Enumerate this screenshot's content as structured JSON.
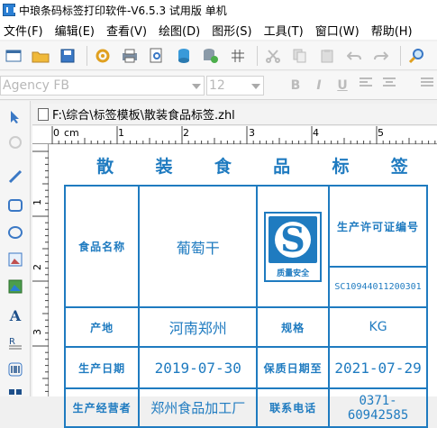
{
  "window": {
    "title": "中琅条码标签打印软件-V6.5.3 试用版 单机"
  },
  "menu": {
    "items": [
      "文件(F)",
      "编辑(E)",
      "查看(V)",
      "绘图(D)",
      "图形(S)",
      "工具(T)",
      "窗口(W)",
      "帮助(H)"
    ]
  },
  "format": {
    "font_name": "Agency FB",
    "font_size": "12"
  },
  "document": {
    "tab_name": "F:\\综合\\标签模板\\散装食品标签.zhl"
  },
  "ruler": {
    "unit": "cm",
    "top_labels": [
      "0",
      "1",
      "2",
      "3",
      "4",
      "5"
    ],
    "left_labels": [
      "1",
      "2",
      "3"
    ]
  },
  "label": {
    "title_chars": [
      "散",
      "装",
      "食",
      "品",
      "标",
      "签"
    ],
    "food_name_label": "食品名称",
    "food_name_value": "葡萄干",
    "license_label": "生产许可证编号",
    "license_value": "SC10944011200301",
    "logo_text": "质量安全",
    "logo_letter": "S",
    "origin_label": "产地",
    "origin_value": "河南郑州",
    "spec_label": "规格",
    "spec_value": "KG",
    "prod_date_label": "生产日期",
    "prod_date_value": "2019-07-30",
    "expiry_label": "保质日期至",
    "expiry_value": "2021-07-29",
    "producer_label": "生产经营者",
    "producer_value": "郑州食品加工厂",
    "phone_label": "联系电话",
    "phone_value": "0371-60942585"
  },
  "colors": {
    "accent": "#1f7bc0"
  }
}
